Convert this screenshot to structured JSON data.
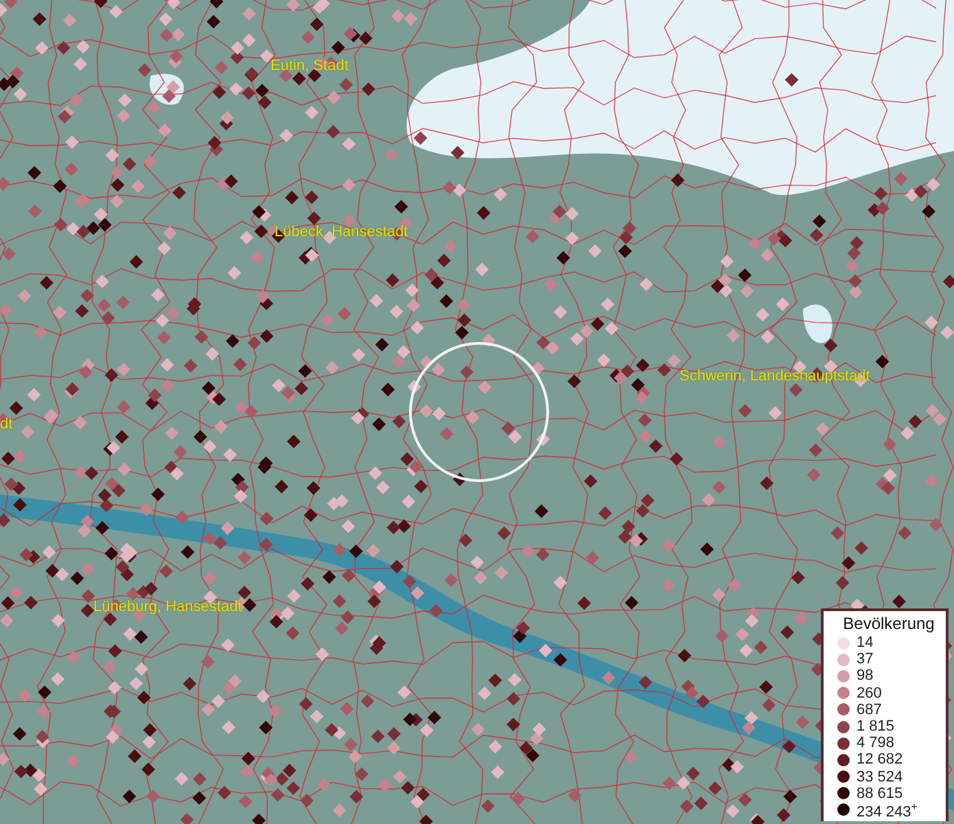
{
  "map": {
    "place_labels": [
      {
        "name": "Eutin, Stadt"
      },
      {
        "name": "Lübeck, Hansestadt"
      },
      {
        "name": "Schwerin, Landeshauptstadt"
      },
      {
        "name": "Lüneburg, Hansestadt"
      },
      {
        "name": "dt"
      }
    ]
  },
  "legend": {
    "title": "Bevölkerung",
    "items": [
      {
        "label": "14",
        "color": "#f4dde6"
      },
      {
        "label": "37",
        "color": "#e4b8c3"
      },
      {
        "label": "98",
        "color": "#d49ea8"
      },
      {
        "label": "260",
        "color": "#c3828d"
      },
      {
        "label": "687",
        "color": "#a95c67"
      },
      {
        "label": "1 815",
        "color": "#91434c"
      },
      {
        "label": "4 798",
        "color": "#7b2e36"
      },
      {
        "label": "12 682",
        "color": "#621b22"
      },
      {
        "label": "33 524",
        "color": "#4a0e13"
      },
      {
        "label": "88 615",
        "color": "#33060a"
      },
      {
        "label": "234 243$^{+}$",
        "color": "#1e0204"
      }
    ]
  }
}
